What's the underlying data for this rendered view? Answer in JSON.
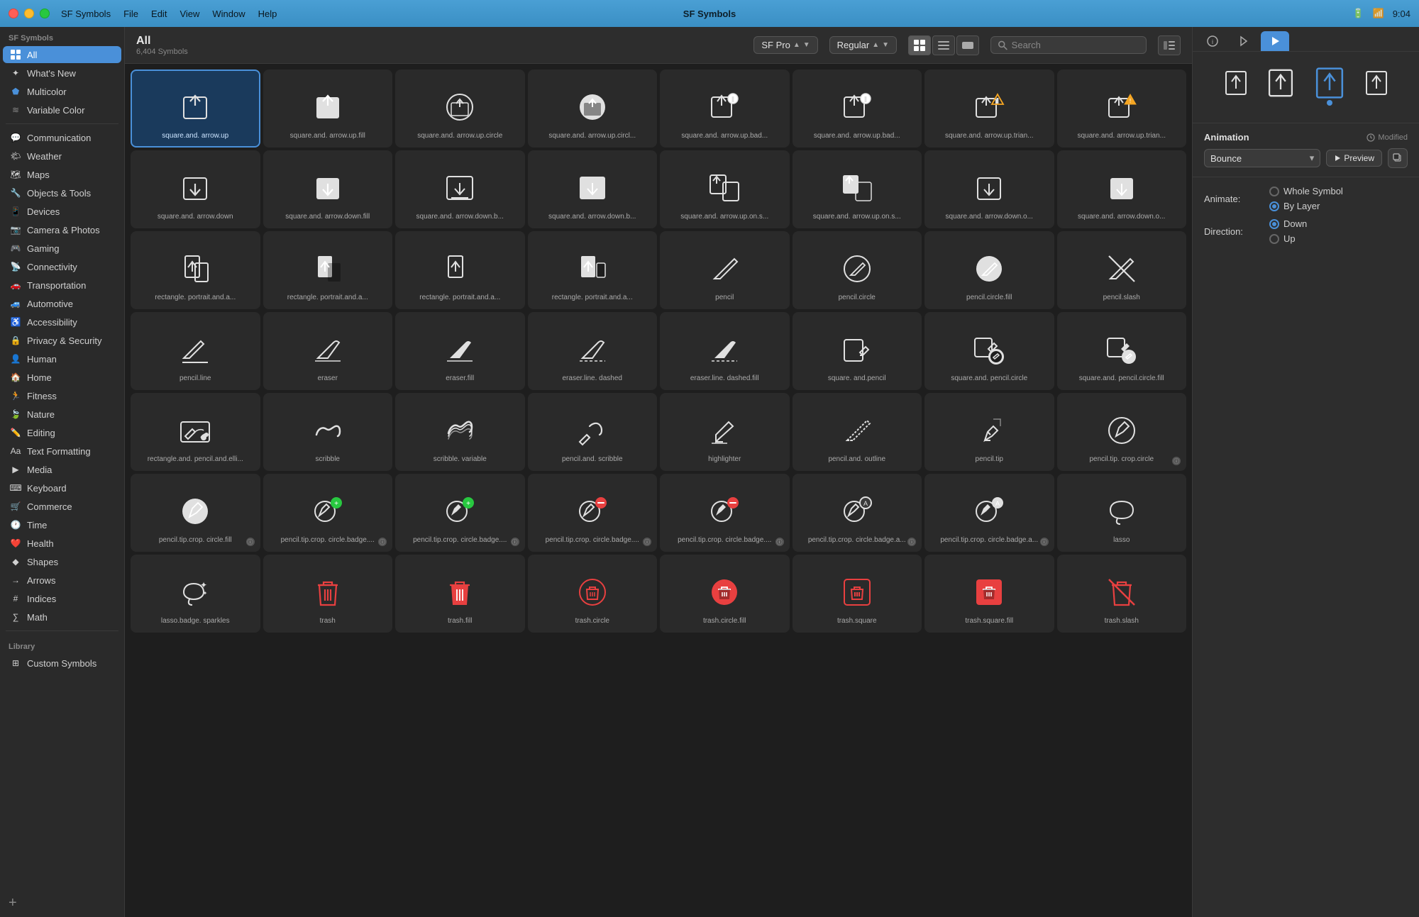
{
  "app": {
    "title": "SF Symbols",
    "time": "9:04"
  },
  "menu": {
    "items": [
      "SF Symbols",
      "File",
      "Edit",
      "View",
      "Window",
      "Help"
    ]
  },
  "sidebar": {
    "section_label": "SF Symbols",
    "items": [
      {
        "id": "all",
        "label": "All",
        "icon": "grid",
        "active": true
      },
      {
        "id": "whats-new",
        "label": "What's New",
        "icon": "sparkle"
      },
      {
        "id": "multicolor",
        "label": "Multicolor",
        "icon": "paintpalette"
      },
      {
        "id": "variable-color",
        "label": "Variable Color",
        "icon": "slider"
      },
      {
        "id": "communication",
        "label": "Communication",
        "icon": "bubble"
      },
      {
        "id": "weather",
        "label": "Weather",
        "icon": "cloud"
      },
      {
        "id": "maps",
        "label": "Maps",
        "icon": "map"
      },
      {
        "id": "objects-tools",
        "label": "Objects & Tools",
        "icon": "hammer"
      },
      {
        "id": "devices",
        "label": "Devices",
        "icon": "iphone"
      },
      {
        "id": "camera-photos",
        "label": "Camera & Photos",
        "icon": "camera"
      },
      {
        "id": "gaming",
        "label": "Gaming",
        "icon": "gamecontroller"
      },
      {
        "id": "connectivity",
        "label": "Connectivity",
        "icon": "wifi"
      },
      {
        "id": "transportation",
        "label": "Transportation",
        "icon": "car"
      },
      {
        "id": "automotive",
        "label": "Automotive",
        "icon": "car2"
      },
      {
        "id": "accessibility",
        "label": "Accessibility",
        "icon": "accessibility"
      },
      {
        "id": "privacy-security",
        "label": "Privacy & Security",
        "icon": "lock"
      },
      {
        "id": "human",
        "label": "Human",
        "icon": "person"
      },
      {
        "id": "home",
        "label": "Home",
        "icon": "house"
      },
      {
        "id": "fitness",
        "label": "Fitness",
        "icon": "figure"
      },
      {
        "id": "nature",
        "label": "Nature",
        "icon": "leaf"
      },
      {
        "id": "editing",
        "label": "Editing",
        "icon": "pencil"
      },
      {
        "id": "text-formatting",
        "label": "Text Formatting",
        "icon": "textformat"
      },
      {
        "id": "media",
        "label": "Media",
        "icon": "play"
      },
      {
        "id": "keyboard",
        "label": "Keyboard",
        "icon": "keyboard"
      },
      {
        "id": "commerce",
        "label": "Commerce",
        "icon": "cart"
      },
      {
        "id": "time",
        "label": "Time",
        "icon": "clock"
      },
      {
        "id": "health",
        "label": "Health",
        "icon": "heart"
      },
      {
        "id": "shapes",
        "label": "Shapes",
        "icon": "shapes"
      },
      {
        "id": "arrows",
        "label": "Arrows",
        "icon": "arrow"
      },
      {
        "id": "indices",
        "label": "Indices",
        "icon": "number"
      },
      {
        "id": "math",
        "label": "Math",
        "icon": "function"
      }
    ],
    "library_label": "Library",
    "library_items": [
      {
        "id": "custom-symbols",
        "label": "Custom Symbols",
        "icon": "custom"
      }
    ],
    "add_label": "+"
  },
  "toolbar": {
    "title": "All",
    "subtitle": "6,404 Symbols",
    "font": "SF Pro",
    "weight": "Regular",
    "search_placeholder": "Search",
    "view_grid": "⊞",
    "view_list": "≡",
    "view_gallery": "▭"
  },
  "symbols": [
    {
      "name": "square.and.\narrow.up",
      "selected": true,
      "type": "share-up",
      "color": "default"
    },
    {
      "name": "square.and.\narrow.up.fill",
      "selected": false,
      "type": "share-up-fill",
      "color": "default"
    },
    {
      "name": "square.and.\narrow.up.circle",
      "selected": false,
      "type": "share-up-circle",
      "color": "default"
    },
    {
      "name": "square.and.\narrow.up.circl...",
      "selected": false,
      "type": "share-up-circle-fill",
      "color": "default"
    },
    {
      "name": "square.and.\narrow.up.bad...",
      "selected": false,
      "type": "share-up-badge",
      "color": "default"
    },
    {
      "name": "square.and.\narrow.up.bad...",
      "selected": false,
      "type": "share-up-badge2",
      "color": "default"
    },
    {
      "name": "square.and.\narrow.up.trian...",
      "selected": false,
      "type": "share-up-triangle",
      "color": "warning"
    },
    {
      "name": "square.and.\narrow.up.trian...",
      "selected": false,
      "type": "share-up-triangle2",
      "color": "warning"
    },
    {
      "name": "square.and.\narrow.down",
      "selected": false,
      "type": "share-down",
      "color": "default"
    },
    {
      "name": "square.and.\narrow.down.fill",
      "selected": false,
      "type": "share-down-fill",
      "color": "default"
    },
    {
      "name": "square.and.\narrow.down.b...",
      "selected": false,
      "type": "share-down-b",
      "color": "default"
    },
    {
      "name": "square.and.\narrow.down.b...",
      "selected": false,
      "type": "share-down-b2",
      "color": "default"
    },
    {
      "name": "square.and.\narrow.up.on.s...",
      "selected": false,
      "type": "share-up-on-s",
      "color": "default"
    },
    {
      "name": "square.and.\narrow.up.on.s...",
      "selected": false,
      "type": "share-up-on-s2",
      "color": "default"
    },
    {
      "name": "square.and.\narrow.down.o...",
      "selected": false,
      "type": "share-down-o",
      "color": "default"
    },
    {
      "name": "square.and.\narrow.down.o...",
      "selected": false,
      "type": "share-down-o2",
      "color": "default"
    },
    {
      "name": "rectangle.\nportrait.and.a...",
      "selected": false,
      "type": "rect-portrait-a",
      "color": "default"
    },
    {
      "name": "rectangle.\nportrait.and.a...",
      "selected": false,
      "type": "rect-portrait-a2",
      "color": "default"
    },
    {
      "name": "rectangle.\nportrait.and.a...",
      "selected": false,
      "type": "rect-portrait-a3",
      "color": "default"
    },
    {
      "name": "rectangle.\nportrait.and.a...",
      "selected": false,
      "type": "rect-portrait-a4",
      "color": "default"
    },
    {
      "name": "pencil",
      "selected": false,
      "type": "pencil",
      "color": "default"
    },
    {
      "name": "pencil.circle",
      "selected": false,
      "type": "pencil-circle",
      "color": "default"
    },
    {
      "name": "pencil.circle.fill",
      "selected": false,
      "type": "pencil-circle-fill",
      "color": "default"
    },
    {
      "name": "pencil.slash",
      "selected": false,
      "type": "pencil-slash",
      "color": "default"
    },
    {
      "name": "pencil.line",
      "selected": false,
      "type": "pencil-line",
      "color": "default"
    },
    {
      "name": "eraser",
      "selected": false,
      "type": "eraser",
      "color": "default"
    },
    {
      "name": "eraser.fill",
      "selected": false,
      "type": "eraser-fill",
      "color": "default"
    },
    {
      "name": "eraser.line.\ndashed",
      "selected": false,
      "type": "eraser-line-dashed",
      "color": "default"
    },
    {
      "name": "eraser.line.\ndashed.fill",
      "selected": false,
      "type": "eraser-line-dashed-fill",
      "color": "default"
    },
    {
      "name": "square.\nand.pencil",
      "selected": false,
      "type": "square-pencil",
      "color": "default"
    },
    {
      "name": "square.and.\npencil.circle",
      "selected": false,
      "type": "square-pencil-circle",
      "color": "default"
    },
    {
      "name": "square.and.\npencil.circle.fill",
      "selected": false,
      "type": "square-pencil-circle-fill",
      "color": "default"
    },
    {
      "name": "rectangle.and.\npencil.and.elli...",
      "selected": false,
      "type": "rect-pencil-elli",
      "color": "default"
    },
    {
      "name": "scribble",
      "selected": false,
      "type": "scribble",
      "color": "default"
    },
    {
      "name": "scribble.\nvariable",
      "selected": false,
      "type": "scribble-variable",
      "color": "default"
    },
    {
      "name": "pencil.and.\nscribble",
      "selected": false,
      "type": "pencil-scribble",
      "color": "default"
    },
    {
      "name": "highlighter",
      "selected": false,
      "type": "highlighter",
      "color": "default"
    },
    {
      "name": "pencil.and.\noutline",
      "selected": false,
      "type": "pencil-outline",
      "color": "default"
    },
    {
      "name": "pencil.tip",
      "selected": false,
      "type": "pencil-tip",
      "color": "default"
    },
    {
      "name": "pencil.tip.\ncrop.circle",
      "selected": false,
      "type": "pencil-tip-crop",
      "color": "default",
      "has_info": true
    },
    {
      "name": "pencil.tip.crop.\ncircle.fill",
      "selected": false,
      "type": "pencil-tip-crop-fill",
      "color": "default",
      "has_info": true
    },
    {
      "name": "pencil.tip.crop.\ncircle.badge....",
      "selected": false,
      "type": "pencil-tip-badge-plus",
      "color": "default",
      "has_info": true,
      "badge": "green"
    },
    {
      "name": "pencil.tip.crop.\ncircle.badge....",
      "selected": false,
      "type": "pencil-tip-badge-plus2",
      "color": "default",
      "has_info": true,
      "badge": "green"
    },
    {
      "name": "pencil.tip.crop.\ncircle.badge....",
      "selected": false,
      "type": "pencil-tip-badge-minus",
      "color": "default",
      "has_info": true,
      "badge": "red"
    },
    {
      "name": "pencil.tip.crop.\ncircle.badge....",
      "selected": false,
      "type": "pencil-tip-badge-minus2",
      "color": "default",
      "has_info": true,
      "badge": "red"
    },
    {
      "name": "pencil.tip.crop.\ncircle.badge.a...",
      "selected": false,
      "type": "pencil-tip-badge-a",
      "color": "default",
      "has_info": true
    },
    {
      "name": "pencil.tip.crop.\ncircle.badge.a...",
      "selected": false,
      "type": "pencil-tip-badge-a2",
      "color": "default",
      "has_info": true
    },
    {
      "name": "lasso",
      "selected": false,
      "type": "lasso",
      "color": "default"
    },
    {
      "name": "lasso.badge.\nsparkles",
      "selected": false,
      "type": "lasso-sparkles",
      "color": "default"
    },
    {
      "name": "trash",
      "selected": false,
      "type": "trash",
      "color": "red"
    },
    {
      "name": "trash.fill",
      "selected": false,
      "type": "trash-fill",
      "color": "red"
    },
    {
      "name": "trash.circle",
      "selected": false,
      "type": "trash-circle",
      "color": "red"
    },
    {
      "name": "trash.circle.fill",
      "selected": false,
      "type": "trash-circle-fill",
      "color": "red"
    },
    {
      "name": "trash.square",
      "selected": false,
      "type": "trash-square",
      "color": "red"
    },
    {
      "name": "trash.square.fill",
      "selected": false,
      "type": "trash-square-fill",
      "color": "red"
    },
    {
      "name": "trash.slash",
      "selected": false,
      "type": "trash-slash",
      "color": "red"
    }
  ],
  "right_panel": {
    "tabs": [
      "info",
      "template",
      "play"
    ],
    "active_tab": "play",
    "preview_variants": 4,
    "animation": {
      "title": "Animation",
      "modified_label": "Modified",
      "type": "Bounce",
      "preview_label": "Preview",
      "animate_label": "Animate:",
      "whole_symbol": "Whole Symbol",
      "by_layer": "By Layer",
      "direction_label": "Direction:",
      "down": "Down",
      "up": "Up",
      "selected_animate": "by_layer",
      "selected_direction": "down"
    }
  }
}
